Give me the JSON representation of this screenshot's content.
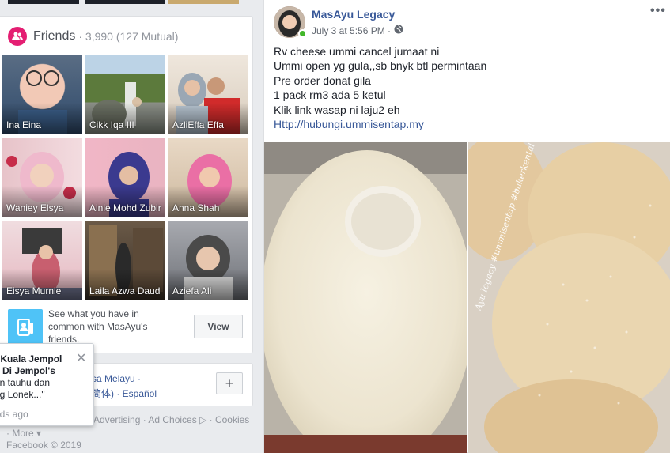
{
  "friends": {
    "title": "Friends",
    "count": "· 3,990 (127 Mutual)",
    "items": [
      {
        "name": "Ina Eina"
      },
      {
        "name": "Cikk Iqa III"
      },
      {
        "name": "AzliEffa Effa"
      },
      {
        "name": "Waniey Elsya"
      },
      {
        "name": "Ainie Mohd Zubir"
      },
      {
        "name": "Anna Shah"
      },
      {
        "name": "Eisya Murnie"
      },
      {
        "name": "Laila Azwa Daud"
      },
      {
        "name": "Aziefa Ali"
      }
    ],
    "common_text": "See what you have in common with MasAyu's friends.",
    "view_label": "View"
  },
  "languages": {
    "line1": "Bahasa Melayu ·",
    "line2": "中文(简体) · Español",
    "plus_label": "+"
  },
  "footer": {
    "links": "Advertising · Ad Choices ▷ · Cookies",
    "more": "· More ▾",
    "copyright": "Facebook © 2019"
  },
  "notification": {
    "line1": "t Kuala Jempol",
    "line2": "k Di Jempol's",
    "line3": "an tauhu dan",
    "line4": "ng Lonek...\"",
    "time": "nds ago",
    "close": "✕"
  },
  "post": {
    "author": "MasAyu Legacy",
    "timestamp": "July 3 at 5:56 PM ·",
    "menu": "•••",
    "lines": [
      "Rv cheese ummi cancel jumaat ni",
      "Ummi open yg gula,,sb bnyk btl permintaan",
      "Pre order donat gila",
      "1 pack rm3 ada 5 ketul",
      "Klik link wasap ni laju2 eh"
    ],
    "link": "Http://hubungi.ummisentap.my",
    "watermark": "Ayu legacy #ummisentap #bakerkental"
  },
  "colors": {
    "link": "#385898",
    "friends_icon": "#e41e72",
    "online": "#42b72a",
    "page_bg": "#e9ebee"
  }
}
